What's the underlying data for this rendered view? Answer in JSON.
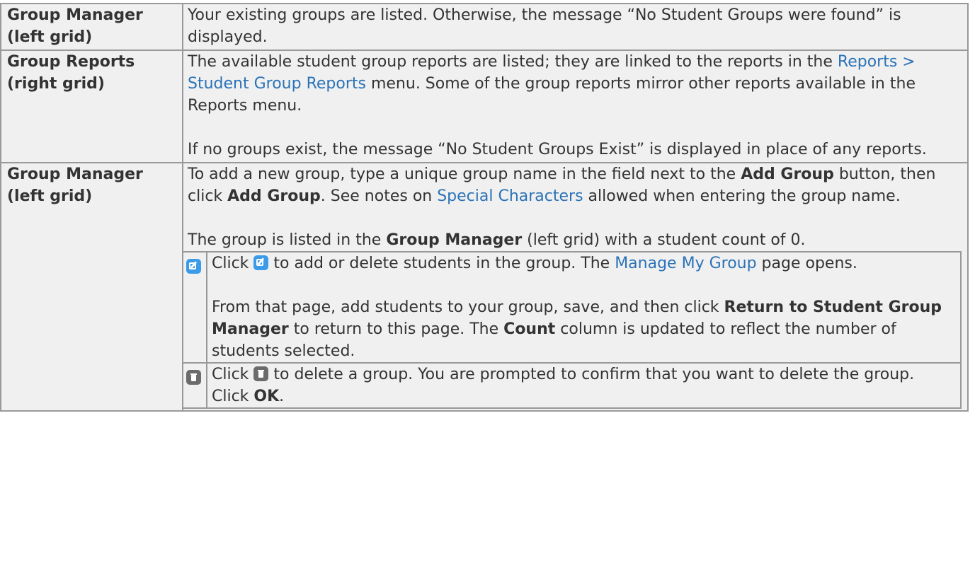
{
  "rows": [
    {
      "label_line1": "Group Manager",
      "label_line2": "(left grid)",
      "text": "Your existing groups are listed. Otherwise, the message “No Student Groups were found” is displayed."
    },
    {
      "label_line1": "Group Reports",
      "label_line2": "(right grid)",
      "p1_a": "The available student group reports are listed; they are linked to the reports in the ",
      "p1_link": "Reports > Student Group Reports",
      "p1_b": " menu. Some of the group reports mirror other reports available in the Reports menu.",
      "p2": "If no groups exist, the message “No Student Groups Exist” is displayed in place of any reports."
    },
    {
      "label_line1": "Group Manager",
      "label_line2": "(left grid)",
      "p1_a": "To add a new group, type a unique group name in the field next to the ",
      "p1_b1": "Add Group",
      "p1_c": " button, then click ",
      "p1_b2": "Add Group",
      "p1_d": ". See notes on ",
      "p1_link": "Special Characters",
      "p1_e": " allowed when entering the group name.",
      "p2_a": "The group is listed in the ",
      "p2_b": "Group Manager",
      "p2_c": " (left grid) with a student count of 0.",
      "edit_row": {
        "icon": "edit-icon",
        "p1_a": "Click ",
        "p1_b": " to add or delete students in the group. The ",
        "p1_link": "Manage My Group",
        "p1_c": " page opens.",
        "p2_a": "From that page, add students to your group, save, and then click ",
        "p2_b": "Return to Student Group Manager",
        "p2_c": " to return to this page. The ",
        "p2_d": "Count",
        "p2_e": " column is updated to reflect the number of students selected."
      },
      "delete_row": {
        "icon": "trash-icon",
        "p1_a": "Click ",
        "p1_b": " to delete a group. You are prompted to confirm that you want to delete the group. Click ",
        "p1_c": "OK",
        "p1_d": "."
      }
    }
  ],
  "colors": {
    "cell_bg": "#f0f0f0",
    "border": "#999999",
    "link": "#2b73b7",
    "edit_icon": "#3b9be8",
    "trash_icon": "#6b6b6b"
  }
}
